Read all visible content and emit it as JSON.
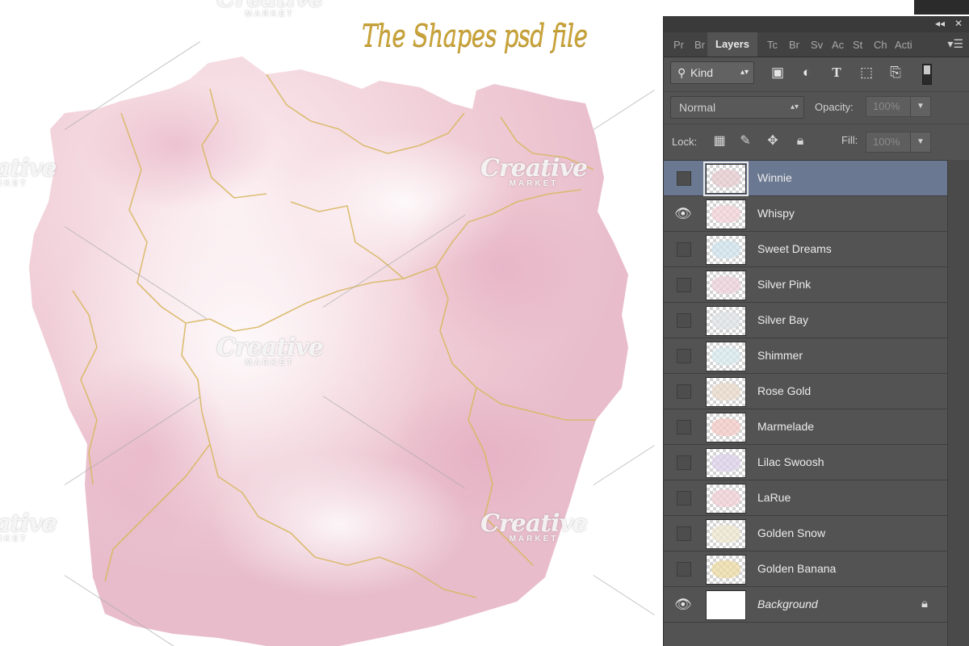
{
  "canvas": {
    "title": "The Shapes psd file",
    "watermark": {
      "word": "Creative",
      "sub": "MARKET"
    }
  },
  "panel": {
    "collapse_label": "◂◂",
    "close_label": "✕",
    "tabs": [
      "Pr",
      "Br",
      "Layers",
      "Tc",
      "Br",
      "Sv",
      "Ac",
      "St",
      "Ch",
      "Acti"
    ],
    "active_tab": "Layers",
    "menu_icon": "panel-menu-icon",
    "filter": {
      "label": "Kind",
      "icons": [
        "image-filter-icon",
        "adjustment-filter-icon",
        "type-filter-icon",
        "shape-filter-icon",
        "smart-object-filter-icon"
      ]
    },
    "blend_mode": "Normal",
    "opacity_label": "Opacity:",
    "opacity_value": "100%",
    "lock_label": "Lock:",
    "lock_icons": [
      "lock-transparent-icon",
      "lock-pixels-icon",
      "lock-position-icon",
      "lock-all-icon"
    ],
    "fill_label": "Fill:",
    "fill_value": "100%",
    "layers": [
      {
        "name": "Winnie",
        "visible": false,
        "selected": true,
        "tint": "#e6c9cf"
      },
      {
        "name": "Whispy",
        "visible": true,
        "selected": false,
        "tint": "#f2d2d8"
      },
      {
        "name": "Sweet Dreams",
        "visible": false,
        "selected": false,
        "tint": "#cfe2ec"
      },
      {
        "name": "Silver Pink",
        "visible": false,
        "selected": false,
        "tint": "#ecd0da"
      },
      {
        "name": "Silver Bay",
        "visible": false,
        "selected": false,
        "tint": "#dfe3e6"
      },
      {
        "name": "Shimmer",
        "visible": false,
        "selected": false,
        "tint": "#d8e9ee"
      },
      {
        "name": "Rose Gold",
        "visible": false,
        "selected": false,
        "tint": "#e9d9c9"
      },
      {
        "name": "Marmelade",
        "visible": false,
        "selected": false,
        "tint": "#f4c9c4"
      },
      {
        "name": "Lilac Swoosh",
        "visible": false,
        "selected": false,
        "tint": "#dcd2ea"
      },
      {
        "name": "LaRue",
        "visible": false,
        "selected": false,
        "tint": "#efcfd6"
      },
      {
        "name": "Golden Snow",
        "visible": false,
        "selected": false,
        "tint": "#eee6cf"
      },
      {
        "name": "Golden Banana",
        "visible": false,
        "selected": false,
        "tint": "#ecd9a3"
      },
      {
        "name": "Background",
        "visible": true,
        "selected": false,
        "tint": "#ffffff",
        "locked": true
      }
    ]
  },
  "colors": {
    "accent_gold": "#c9a43a",
    "selection": "#6a7891",
    "panel_bg": "#535353"
  }
}
